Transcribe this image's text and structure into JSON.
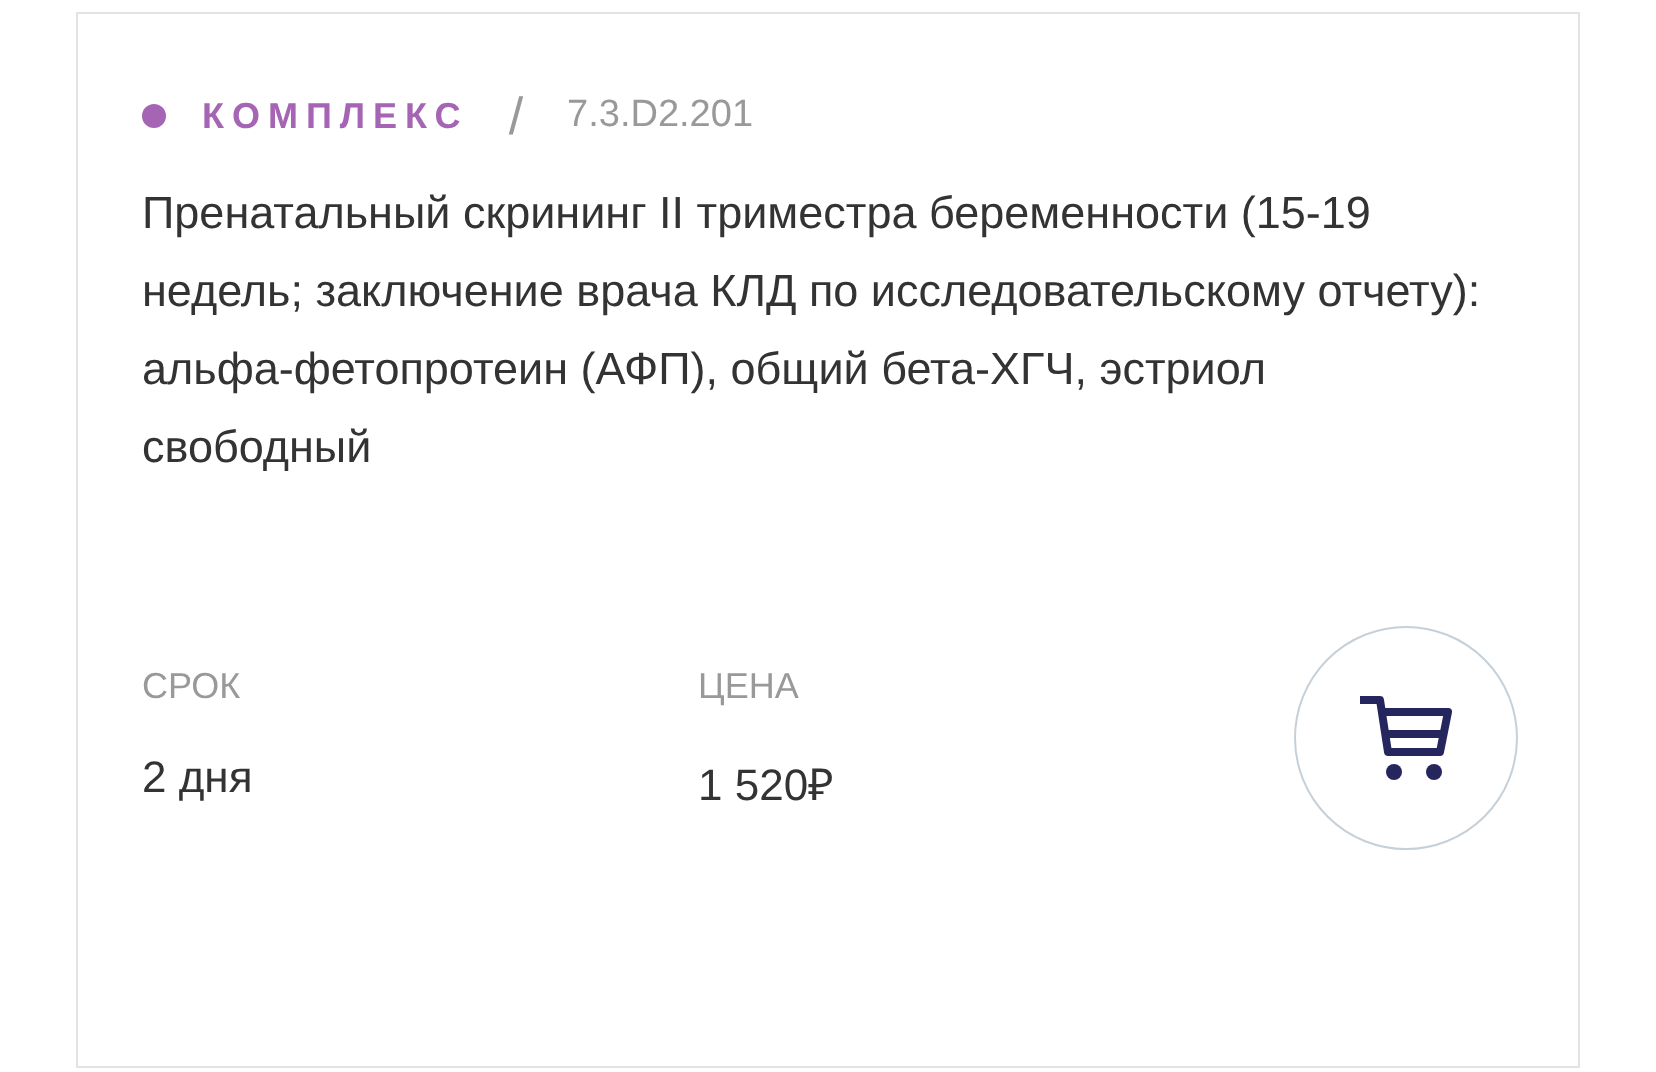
{
  "category": {
    "label": "КОМПЛЕКС",
    "color": "#a564b4"
  },
  "separator": "/",
  "code": "7.3.D2.201",
  "title": "Пренатальный скрининг II триместра беременности (15-19 недель; заключение врача КЛД по исследовательскому отчету): альфа-фетопротеин (АФП), общий бета-ХГЧ, эстриол свободный",
  "fields": [
    {
      "label": "СРОК",
      "value": "2 дня"
    },
    {
      "label": "ЦЕНА",
      "value": "1 520₽"
    }
  ]
}
